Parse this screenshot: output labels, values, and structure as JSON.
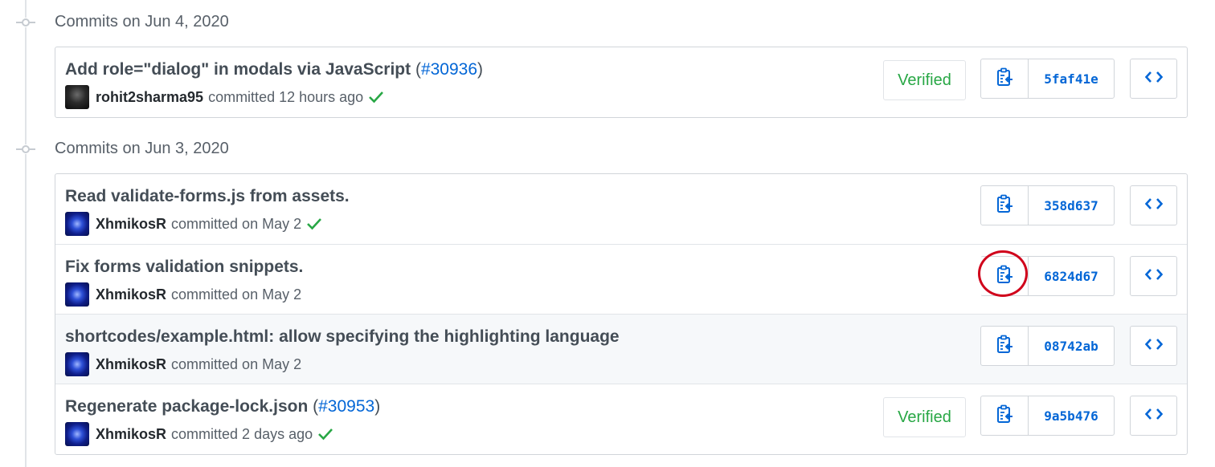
{
  "groups": [
    {
      "title": "Commits on Jun 4, 2020",
      "commits": [
        {
          "title": "Add role=\"dialog\" in modals via JavaScript",
          "pr_open": " (",
          "pr": "#30936",
          "pr_close": ")",
          "author": "rohit2sharma95",
          "meta": "committed 12 hours ago",
          "verified": "Verified",
          "sha": "5faf41e"
        }
      ]
    },
    {
      "title": "Commits on Jun 3, 2020",
      "commits": [
        {
          "title": "Read validate-forms.js from assets.",
          "author": "XhmikosR",
          "meta": "committed on May 2",
          "sha": "358d637"
        },
        {
          "title": "Fix forms validation snippets.",
          "author": "XhmikosR",
          "meta": "committed on May 2",
          "sha": "6824d67"
        },
        {
          "title": "shortcodes/example.html: allow specifying the highlighting language",
          "author": "XhmikosR",
          "meta": "committed on May 2",
          "sha": "08742ab"
        },
        {
          "title": "Regenerate package-lock.json",
          "pr_open": " (",
          "pr": "#30953",
          "pr_close": ")",
          "author": "XhmikosR",
          "meta": "committed 2 days ago",
          "verified": "Verified",
          "sha": "9a5b476"
        }
      ]
    }
  ],
  "colors": {
    "link": "#0366d6",
    "success": "#28a745",
    "annotation": "#d0021b"
  },
  "icons": {
    "copy": "clippy-icon",
    "browse": "code-icon",
    "status": "check-icon",
    "timeline": "git-commit-icon"
  }
}
